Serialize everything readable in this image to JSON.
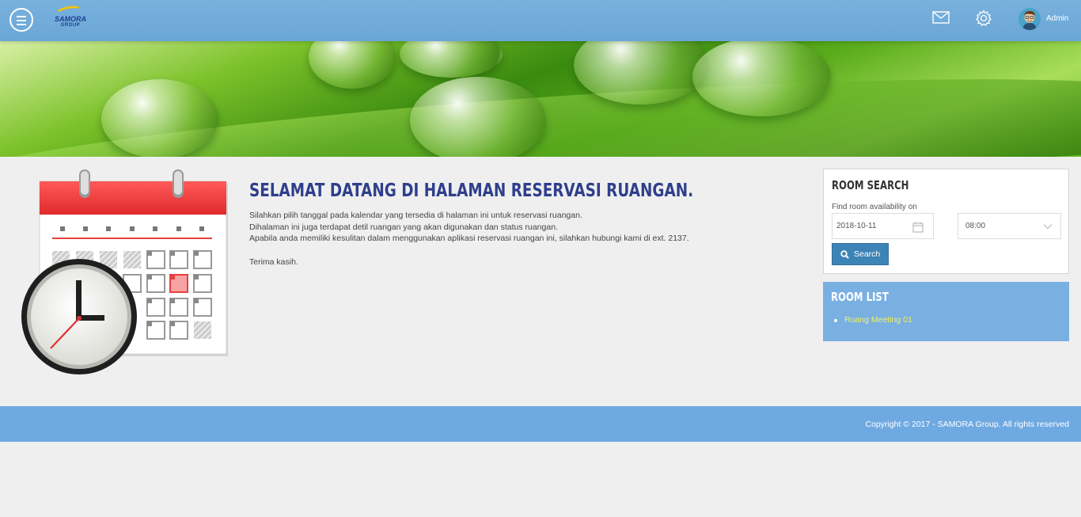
{
  "header": {
    "logo_text": "SAMORA",
    "logo_sub": "GROUP",
    "user_name": "Admin",
    "icons": [
      "menu-icon",
      "mail-icon",
      "gear-icon",
      "avatar"
    ]
  },
  "welcome": {
    "title": "SELAMAT DATANG DI HALAMAN RESERVASI RUANGAN.",
    "lines": [
      "Silahkan pilih tanggal pada kalendar yang tersedia di halaman ini untuk reservasi ruangan.",
      "Dihalaman ini juga terdapat detil ruangan yang akan digunakan dan status ruangan.",
      "Apabila anda memiliki kesulitan dalam menggunakan aplikasi reservasi ruangan ini, silahkan hubungi kami di ext. 2137."
    ],
    "closing": "Terima kasih."
  },
  "room_search": {
    "title": "ROOM SEARCH",
    "find_label": "Find room availability on",
    "date_value": "2018-10-11",
    "time_value": "08:00",
    "button_label": "Search"
  },
  "room_list": {
    "title": "ROOM LIST",
    "items": [
      "Ruang Meeting 01"
    ]
  },
  "footer": {
    "copyright": "Copyright © 2017 - SAMORA Group. All rights reserved"
  },
  "colors": {
    "header": "#6aa6d6",
    "title_blue": "#2f3f8c",
    "button_blue": "#3d84b6",
    "list_bg": "#7aafe2",
    "list_link": "#f4f15a",
    "footer": "#6fa9e1"
  }
}
